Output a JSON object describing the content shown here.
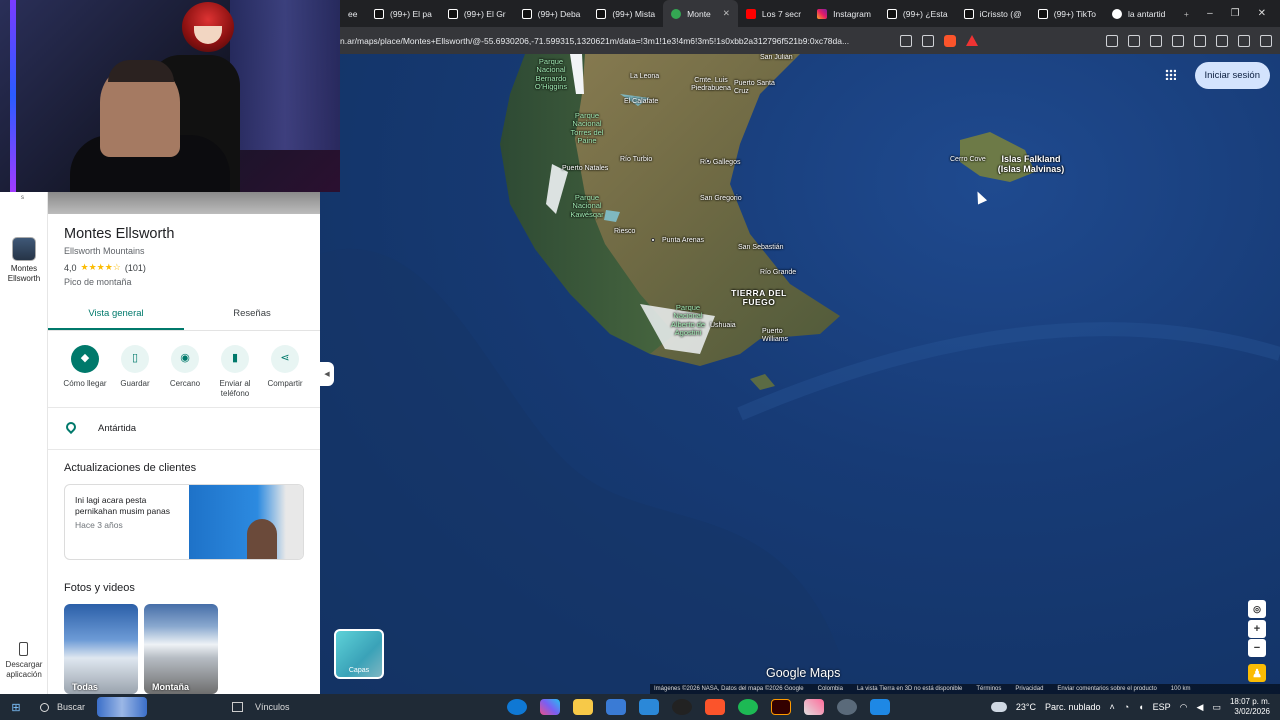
{
  "browser": {
    "tabs": [
      {
        "label": "(99+) El pa",
        "active": false
      },
      {
        "label": "(99+) El Gr",
        "active": false
      },
      {
        "label": "(99+) Deba",
        "active": false
      },
      {
        "label": "(99+) Mista",
        "active": false
      },
      {
        "label": "Monte",
        "active": true
      },
      {
        "label": "Los 7 secr",
        "active": false
      },
      {
        "label": "Instagram",
        "active": false
      },
      {
        "label": "(99+) ¿Esta",
        "active": false
      },
      {
        "label": "iCrissto (@",
        "active": false
      },
      {
        "label": "(99+) TikTo",
        "active": false
      },
      {
        "label": "la antartid",
        "active": false
      }
    ],
    "url": "n.ar/maps/place/Montes+Ellsworth/@-55.6930206,-71.599315,1320621m/data=!3m1!1e3!4m6!3m5!1s0xbb2a312796f521b9:0xc78da..."
  },
  "rail": {
    "saved_label": "Montes Ellsworth",
    "download_label": "Descargar aplicación"
  },
  "place": {
    "title": "Montes Ellsworth",
    "subtitle": "Ellsworth Mountains",
    "rating": "4,0",
    "stars": "★★★★☆",
    "reviews": "(101)",
    "type": "Pico de montaña",
    "tabs": [
      "Vista general",
      "Reseñas"
    ],
    "actions": [
      "Cómo llegar",
      "Guardar",
      "Cercano",
      "Enviar al teléfono",
      "Compartir"
    ],
    "location": "Antártida",
    "updates_heading": "Actualizaciones de clientes",
    "update_text": "Ini lagi acara pesta pernikahan musim panas",
    "update_time": "Hace 3 años",
    "photos_heading": "Fotos y videos",
    "photos": [
      "Todas",
      "Montaña"
    ]
  },
  "map": {
    "signin": "Iniciar sesión",
    "layers": "Capas",
    "brand": "Google Maps",
    "labels": {
      "san_julian": "San Julián",
      "la_leona": "La Leona",
      "cmte_luis": "Cmte. Luis Piedrabuena",
      "puerto_santa_cruz": "Puerto Santa Cruz",
      "el_calafate": "El Calafate",
      "park_bernardo": "Parque Nacional Bernardo O'Higgins",
      "park_torres": "Parque Nacional Torres del Paine",
      "rio_turbio": "Río Turbio",
      "rio_gallegos": "Río Gallegos",
      "puerto_natales": "Puerto Natales",
      "san_gregorio": "San Gregorio",
      "park_kawesqar": "Parque Nacional Kawésqar",
      "riesco": "Riesco",
      "punta_arenas": "Punta Arenas",
      "san_sebastian": "San Sebastián",
      "rio_grande": "Río Grande",
      "tierra_del_fuego": "TIERRA DEL FUEGO",
      "park_agostini": "Parque Nacional Alberto de Agostini",
      "ushuaia": "Ushuaia",
      "puerto_williams": "Puerto Williams",
      "cerro_cove": "Cerro Cove",
      "falklands": "Islas Falkland (Islas Malvinas)"
    },
    "footer": [
      "Imágenes ©2026 NASA, Datos del mapa ©2026 Google",
      "Colombia",
      "La vista Tierra en 3D no está disponible",
      "Términos",
      "Privacidad",
      "Enviar comentarios sobre el producto",
      "100 km"
    ]
  },
  "taskbar": {
    "search": "Buscar",
    "vinculos": "Vínculos",
    "temp": "23°C",
    "weather": "Parc. nublado",
    "lang": "ESP",
    "time": "18:07 p. m.",
    "date": "3/02/2026"
  }
}
